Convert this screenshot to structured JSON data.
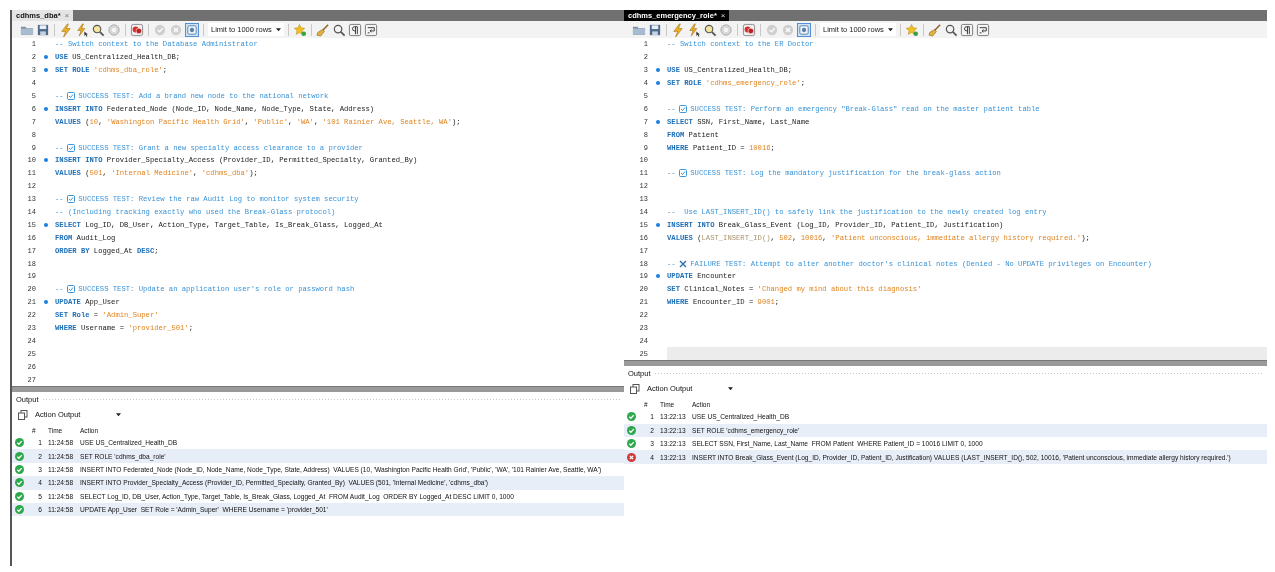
{
  "panes": [
    {
      "tab": {
        "label": "cdhms_dba*",
        "close": "×",
        "selected": false
      },
      "toolbar": {
        "limit": "Limit to 1000 rows"
      },
      "editor": {
        "lines": [
          {
            "number": "1",
            "marker": false,
            "current": false,
            "segments": [
              {
                "kind": "comment",
                "text": "-- Switch context to the Database Administrator"
              }
            ]
          },
          {
            "number": "2",
            "marker": true,
            "current": false,
            "segments": [
              {
                "kind": "keyword",
                "text": "USE"
              },
              {
                "kind": "plain",
                "text": " US_Centralized_Health_DB;"
              }
            ]
          },
          {
            "number": "3",
            "marker": true,
            "current": false,
            "segments": [
              {
                "kind": "keyword",
                "text": "SET ROLE "
              },
              {
                "kind": "string",
                "text": "'cdhms_dba_role'"
              },
              {
                "kind": "plain",
                "text": ";"
              }
            ]
          },
          {
            "number": "4",
            "marker": false,
            "current": false
          },
          {
            "number": "5",
            "marker": false,
            "current": false,
            "segments": [
              {
                "kind": "comment",
                "text": "-- "
              },
              {
                "kind": "check"
              },
              {
                "kind": "comment",
                "text": " SUCCESS TEST: Add a brand new node to the national network"
              }
            ]
          },
          {
            "number": "6",
            "marker": true,
            "current": false,
            "segments": [
              {
                "kind": "keyword",
                "text": "INSERT INTO"
              },
              {
                "kind": "plain",
                "text": " Federated_Node (Node_ID, Node_Name, Node_Type, State, Address)"
              }
            ]
          },
          {
            "number": "7",
            "marker": false,
            "current": false,
            "segments": [
              {
                "kind": "keyword",
                "text": "VALUES"
              },
              {
                "kind": "plain",
                "text": " ("
              },
              {
                "kind": "number",
                "text": "10"
              },
              {
                "kind": "plain",
                "text": ", "
              },
              {
                "kind": "string",
                "text": "'Washington Pacific Health Grid'"
              },
              {
                "kind": "plain",
                "text": ", "
              },
              {
                "kind": "string",
                "text": "'Public'"
              },
              {
                "kind": "plain",
                "text": ", "
              },
              {
                "kind": "string",
                "text": "'WA'"
              },
              {
                "kind": "plain",
                "text": ", "
              },
              {
                "kind": "string",
                "text": "'101 Rainier Ave, Seattle, WA'"
              },
              {
                "kind": "plain",
                "text": ");"
              }
            ]
          },
          {
            "number": "8",
            "marker": false,
            "current": false
          },
          {
            "number": "9",
            "marker": false,
            "current": false,
            "segments": [
              {
                "kind": "comment",
                "text": "-- "
              },
              {
                "kind": "check"
              },
              {
                "kind": "comment",
                "text": " SUCCESS TEST: Grant a new specialty access clearance to a provider"
              }
            ]
          },
          {
            "number": "10",
            "marker": true,
            "current": false,
            "segments": [
              {
                "kind": "keyword",
                "text": "INSERT INTO"
              },
              {
                "kind": "plain",
                "text": " Provider_Specialty_Access (Provider_ID, Permitted_Specialty, Granted_By)"
              }
            ]
          },
          {
            "number": "11",
            "marker": false,
            "current": false,
            "segments": [
              {
                "kind": "keyword",
                "text": "VALUES"
              },
              {
                "kind": "plain",
                "text": " ("
              },
              {
                "kind": "number",
                "text": "501"
              },
              {
                "kind": "plain",
                "text": ", "
              },
              {
                "kind": "string",
                "text": "'Internal Medicine'"
              },
              {
                "kind": "plain",
                "text": ", "
              },
              {
                "kind": "string",
                "text": "'cdhms_dba'"
              },
              {
                "kind": "plain",
                "text": ");"
              }
            ]
          },
          {
            "number": "12",
            "marker": false,
            "current": false
          },
          {
            "number": "13",
            "marker": false,
            "current": false,
            "segments": [
              {
                "kind": "comment",
                "text": "-- "
              },
              {
                "kind": "check"
              },
              {
                "kind": "comment",
                "text": " SUCCESS TEST: Review the raw Audit Log to monitor system security"
              }
            ]
          },
          {
            "number": "14",
            "marker": false,
            "current": false,
            "segments": [
              {
                "kind": "comment",
                "text": "-- (Including tracking exactly who used the Break-Glass protocol)"
              }
            ]
          },
          {
            "number": "15",
            "marker": true,
            "current": false,
            "segments": [
              {
                "kind": "keyword",
                "text": "SELECT"
              },
              {
                "kind": "plain",
                "text": " Log_ID, DB_User, Action_Type, Target_Table, Is_Break_Glass, Logged_At"
              }
            ]
          },
          {
            "number": "16",
            "marker": false,
            "current": false,
            "segments": [
              {
                "kind": "keyword",
                "text": "FROM"
              },
              {
                "kind": "plain",
                "text": " Audit_Log"
              }
            ]
          },
          {
            "number": "17",
            "marker": false,
            "current": false,
            "segments": [
              {
                "kind": "keyword",
                "text": "ORDER BY"
              },
              {
                "kind": "plain",
                "text": " Logged_At "
              },
              {
                "kind": "keyword",
                "text": "DESC"
              },
              {
                "kind": "plain",
                "text": ";"
              }
            ]
          },
          {
            "number": "18",
            "marker": false,
            "current": false
          },
          {
            "number": "19",
            "marker": false,
            "current": false
          },
          {
            "number": "20",
            "marker": false,
            "current": false,
            "segments": [
              {
                "kind": "comment",
                "text": "-- "
              },
              {
                "kind": "check"
              },
              {
                "kind": "comment",
                "text": " SUCCESS TEST: Update an application user's role or password hash"
              }
            ]
          },
          {
            "number": "21",
            "marker": true,
            "current": false,
            "segments": [
              {
                "kind": "keyword",
                "text": "UPDATE"
              },
              {
                "kind": "plain",
                "text": " App_User"
              }
            ]
          },
          {
            "number": "22",
            "marker": false,
            "current": false,
            "segments": [
              {
                "kind": "keyword",
                "text": "SET Role"
              },
              {
                "kind": "plain",
                "text": " = "
              },
              {
                "kind": "string",
                "text": "'Admin_Super'"
              }
            ]
          },
          {
            "number": "23",
            "marker": false,
            "current": false,
            "segments": [
              {
                "kind": "keyword",
                "text": "WHERE"
              },
              {
                "kind": "plain",
                "text": " Username = "
              },
              {
                "kind": "string",
                "text": "'provider_501'"
              },
              {
                "kind": "plain",
                "text": ";"
              }
            ]
          },
          {
            "number": "24",
            "marker": false,
            "current": false
          },
          {
            "number": "25",
            "marker": false,
            "current": false
          },
          {
            "number": "26",
            "marker": false,
            "current": false
          },
          {
            "number": "27",
            "marker": false,
            "current": false
          }
        ]
      },
      "output": {
        "title": "Output",
        "view": "Action Output",
        "columns": [
          "#",
          "Time",
          "Action"
        ],
        "rows": [
          {
            "success": true,
            "number": "1",
            "time": "11:24:58",
            "action": "USE US_Centralized_Health_DB"
          },
          {
            "success": true,
            "number": "2",
            "time": "11:24:58",
            "action": "SET ROLE 'cdhms_dba_role'"
          },
          {
            "success": true,
            "number": "3",
            "time": "11:24:58",
            "action": "INSERT INTO Federated_Node (Node_ID, Node_Name, Node_Type, State, Address)  VALUES (10, 'Washington Pacific Health Grid', 'Public', 'WA', '101 Rainier Ave, Seattle, WA')"
          },
          {
            "success": true,
            "number": "4",
            "time": "11:24:58",
            "action": "INSERT INTO Provider_Specialty_Access (Provider_ID, Permitted_Specialty, Granted_By)  VALUES (501, 'Internal Medicine', 'cdhms_dba')"
          },
          {
            "success": true,
            "number": "5",
            "time": "11:24:58",
            "action": "SELECT Log_ID, DB_User, Action_Type, Target_Table, Is_Break_Glass, Logged_At  FROM Audit_Log  ORDER BY Logged_At DESC LIMIT 0, 1000"
          },
          {
            "success": true,
            "number": "6",
            "time": "11:24:58",
            "action": "UPDATE App_User  SET Role = 'Admin_Super'  WHERE Username = 'provider_501'"
          }
        ]
      }
    },
    {
      "tab": {
        "label": "cdhms_emergency_role*",
        "close": "×",
        "selected": true
      },
      "toolbar": {
        "limit": "Limit to 1000 rows"
      },
      "editor": {
        "lines": [
          {
            "number": "1",
            "marker": false,
            "current": false,
            "segments": [
              {
                "kind": "comment",
                "text": "-- Switch context to the ER Doctor"
              }
            ]
          },
          {
            "number": "2",
            "marker": false,
            "current": false
          },
          {
            "number": "3",
            "marker": true,
            "current": false,
            "segments": [
              {
                "kind": "keyword",
                "text": "USE"
              },
              {
                "kind": "plain",
                "text": " US_Centralized_Health_DB;"
              }
            ]
          },
          {
            "number": "4",
            "marker": true,
            "current": false,
            "segments": [
              {
                "kind": "keyword",
                "text": "SET ROLE "
              },
              {
                "kind": "string",
                "text": "'cdhms_emergency_role'"
              },
              {
                "kind": "plain",
                "text": ";"
              }
            ]
          },
          {
            "number": "5",
            "marker": false,
            "current": false
          },
          {
            "number": "6",
            "marker": false,
            "current": false,
            "segments": [
              {
                "kind": "comment",
                "text": "-- "
              },
              {
                "kind": "check"
              },
              {
                "kind": "comment",
                "text": " SUCCESS TEST: Perform an emergency \"Break-Glass\" read on the master patient table"
              }
            ]
          },
          {
            "number": "7",
            "marker": true,
            "current": false,
            "segments": [
              {
                "kind": "keyword",
                "text": "SELECT"
              },
              {
                "kind": "plain",
                "text": " SSN, First_Name, Last_Name"
              }
            ]
          },
          {
            "number": "8",
            "marker": false,
            "current": false,
            "segments": [
              {
                "kind": "keyword",
                "text": "FROM"
              },
              {
                "kind": "plain",
                "text": " Patient"
              }
            ]
          },
          {
            "number": "9",
            "marker": false,
            "current": false,
            "segments": [
              {
                "kind": "keyword",
                "text": "WHERE"
              },
              {
                "kind": "plain",
                "text": " Patient_ID = "
              },
              {
                "kind": "number",
                "text": "10016"
              },
              {
                "kind": "plain",
                "text": ";"
              }
            ]
          },
          {
            "number": "10",
            "marker": false,
            "current": false
          },
          {
            "number": "11",
            "marker": false,
            "current": false,
            "segments": [
              {
                "kind": "comment",
                "text": "-- "
              },
              {
                "kind": "check"
              },
              {
                "kind": "comment",
                "text": " SUCCESS TEST: Log the mandatory justification for the break-glass action"
              }
            ]
          },
          {
            "number": "12",
            "marker": false,
            "current": false
          },
          {
            "number": "13",
            "marker": false,
            "current": false
          },
          {
            "number": "14",
            "marker": false,
            "current": false,
            "segments": [
              {
                "kind": "comment",
                "text": "--  Use LAST_INSERT_ID() to safely link the justification to the newly created log entry"
              }
            ]
          },
          {
            "number": "15",
            "marker": true,
            "current": false,
            "segments": [
              {
                "kind": "keyword",
                "text": "INSERT INTO"
              },
              {
                "kind": "plain",
                "text": " Break_Glass_Event (Log_ID, Provider_ID, Patient_ID, Justification)"
              }
            ]
          },
          {
            "number": "16",
            "marker": false,
            "current": false,
            "segments": [
              {
                "kind": "keyword",
                "text": "VALUES"
              },
              {
                "kind": "plain",
                "text": " ("
              },
              {
                "kind": "function",
                "text": "LAST_INSERT_ID()"
              },
              {
                "kind": "plain",
                "text": ", "
              },
              {
                "kind": "number",
                "text": "502"
              },
              {
                "kind": "plain",
                "text": ", "
              },
              {
                "kind": "number",
                "text": "10016"
              },
              {
                "kind": "plain",
                "text": ", "
              },
              {
                "kind": "string",
                "text": "'Patient unconscious, immediate allergy history required.'"
              },
              {
                "kind": "plain",
                "text": ");"
              }
            ]
          },
          {
            "number": "17",
            "marker": false,
            "current": false
          },
          {
            "number": "18",
            "marker": false,
            "current": false,
            "segments": [
              {
                "kind": "comment",
                "text": "-- "
              },
              {
                "kind": "cross"
              },
              {
                "kind": "comment",
                "text": " FAILURE TEST: Attempt to alter another doctor's clinical notes (Denied - No UPDATE privileges on Encounter)"
              }
            ]
          },
          {
            "number": "19",
            "marker": true,
            "current": false,
            "segments": [
              {
                "kind": "keyword",
                "text": "UPDATE"
              },
              {
                "kind": "plain",
                "text": " Encounter"
              }
            ]
          },
          {
            "number": "20",
            "marker": false,
            "current": false,
            "segments": [
              {
                "kind": "keyword",
                "text": "SET"
              },
              {
                "kind": "plain",
                "text": " Clinical_Notes = "
              },
              {
                "kind": "string",
                "text": "'Changed my mind about this diagnosis'"
              }
            ]
          },
          {
            "number": "21",
            "marker": false,
            "current": false,
            "segments": [
              {
                "kind": "keyword",
                "text": "WHERE"
              },
              {
                "kind": "plain",
                "text": " Encounter_ID = "
              },
              {
                "kind": "number",
                "text": "9001"
              },
              {
                "kind": "plain",
                "text": ";"
              }
            ]
          },
          {
            "number": "22",
            "marker": false,
            "current": false
          },
          {
            "number": "23",
            "marker": false,
            "current": false
          },
          {
            "number": "24",
            "marker": false,
            "current": false
          },
          {
            "number": "25",
            "marker": false,
            "current": true
          }
        ]
      },
      "output": {
        "title": "Output",
        "view": "Action Output",
        "columns": [
          "#",
          "Time",
          "Action"
        ],
        "rows": [
          {
            "success": true,
            "number": "1",
            "time": "13:22:13",
            "action": "USE US_Centralized_Health_DB"
          },
          {
            "success": true,
            "number": "2",
            "time": "13:22:13",
            "action": "SET ROLE 'cdhms_emergency_role'"
          },
          {
            "success": true,
            "number": "3",
            "time": "13:22:13",
            "action": "SELECT SSN, First_Name, Last_Name  FROM Patient  WHERE Patient_ID = 10016 LIMIT 0, 1000"
          },
          {
            "success": false,
            "number": "4",
            "time": "13:22:13",
            "action": "INSERT INTO Break_Glass_Event (Log_ID, Provider_ID, Patient_ID, Justification) VALUES (LAST_INSERT_ID(), 502, 10016, 'Patient unconscious, immediate allergy history required.')"
          }
        ]
      }
    }
  ]
}
